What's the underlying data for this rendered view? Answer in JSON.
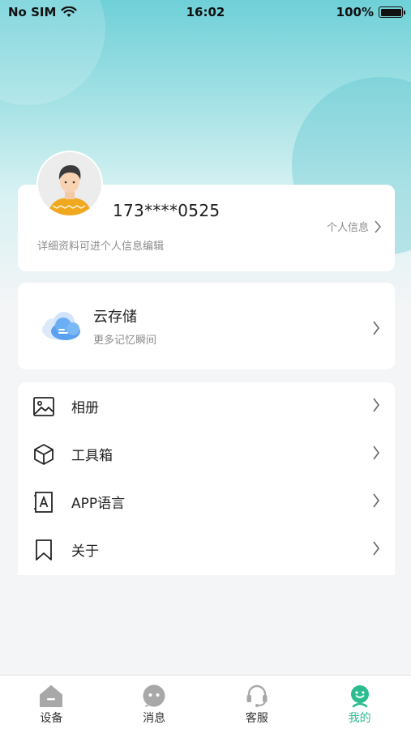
{
  "status_bar": {
    "carrier": "No SIM",
    "time": "16:02",
    "battery": "100%"
  },
  "profile": {
    "phone": "173****0525",
    "hint": "详细资料可进个人信息编辑",
    "link_label": "个人信息"
  },
  "cloud": {
    "title": "云存储",
    "subtitle": "更多记忆瞬间"
  },
  "menu": {
    "items": [
      {
        "label": "相册",
        "icon": "image-icon"
      },
      {
        "label": "工具箱",
        "icon": "box-icon"
      },
      {
        "label": "APP语言",
        "icon": "language-icon"
      },
      {
        "label": "关于",
        "icon": "bookmark-icon"
      }
    ]
  },
  "tabs": [
    {
      "label": "设备",
      "icon": "home-device-icon"
    },
    {
      "label": "消息",
      "icon": "message-icon"
    },
    {
      "label": "客服",
      "icon": "headset-icon"
    },
    {
      "label": "我的",
      "icon": "profile-face-icon",
      "active": true
    }
  ],
  "colors": {
    "accent": "#2bbd8f",
    "header_gradient_top": "#6fd0d8"
  }
}
